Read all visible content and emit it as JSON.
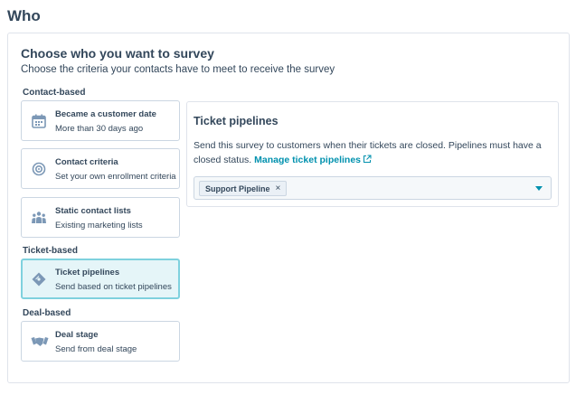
{
  "page_title": "Who",
  "panel": {
    "heading": "Choose who you want to survey",
    "description": "Choose the criteria your contacts have to meet to receive the survey"
  },
  "sections": {
    "contact_based": "Contact-based",
    "ticket_based": "Ticket-based",
    "deal_based": "Deal-based"
  },
  "options": [
    {
      "title": "Became a customer date",
      "subtitle": "More than 30 days ago",
      "icon": "calendar-icon",
      "selected": false
    },
    {
      "title": "Contact criteria",
      "subtitle": "Set your own enrollment criteria",
      "icon": "target-icon",
      "selected": false
    },
    {
      "title": "Static contact lists",
      "subtitle": "Existing marketing lists",
      "icon": "people-icon",
      "selected": false
    },
    {
      "title": "Ticket pipelines",
      "subtitle": "Send based on ticket pipelines",
      "icon": "ticket-icon",
      "selected": true
    },
    {
      "title": "Deal stage",
      "subtitle": "Send from deal stage",
      "icon": "handshake-icon",
      "selected": false
    }
  ],
  "detail": {
    "title": "Ticket pipelines",
    "description": "Send this survey to customers when their tickets are closed. Pipelines must have a closed status.",
    "link_label": "Manage ticket pipelines",
    "link_icon": "external-link-icon",
    "selected_tag": "Support Pipeline",
    "remove_symbol": "×"
  },
  "colors": {
    "text": "#33475b",
    "link": "#0091ae",
    "selected_bg": "#e5f5f8",
    "selected_border": "#7fd1de",
    "icon": "#7c98b6"
  }
}
